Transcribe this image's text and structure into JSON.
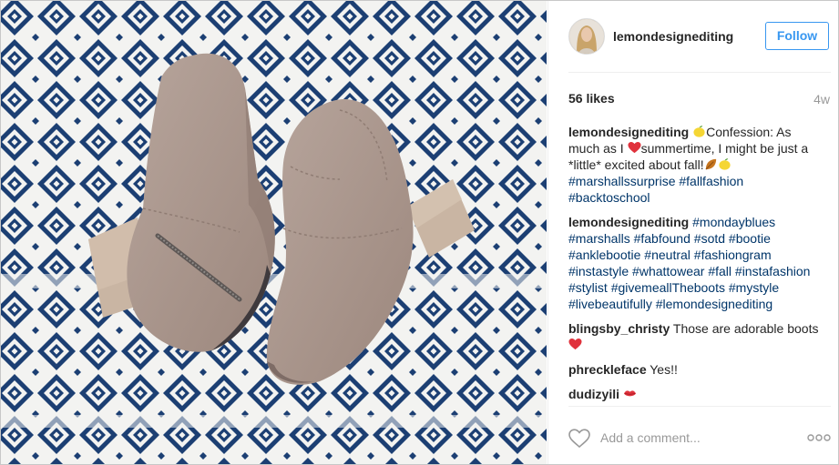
{
  "post": {
    "username": "lemondesignediting",
    "follow_label": "Follow",
    "likes": "56 likes",
    "age": "4w"
  },
  "comments": [
    {
      "user": "lemondesignediting",
      "parts": [
        {
          "t": "emoji",
          "name": "lemon-icon"
        },
        {
          "t": "text",
          "v": "Confession: As much as I "
        },
        {
          "t": "emoji",
          "name": "heart-icon"
        },
        {
          "t": "text",
          "v": "summertime, I might be just a *little* excited about fall!"
        },
        {
          "t": "emoji",
          "name": "leaf-icon"
        },
        {
          "t": "emoji",
          "name": "lemon-icon"
        },
        {
          "t": "tag",
          "v": "#marshallssurprise"
        },
        {
          "t": "text",
          "v": " "
        },
        {
          "t": "tag",
          "v": "#fallfashion"
        },
        {
          "t": "text",
          "v": " "
        },
        {
          "t": "tag",
          "v": "#backtoschool"
        }
      ]
    },
    {
      "user": "lemondesignediting",
      "parts": [
        {
          "t": "tag",
          "v": "#mondayblues"
        },
        {
          "t": "text",
          "v": " "
        },
        {
          "t": "tag",
          "v": "#marshalls"
        },
        {
          "t": "text",
          "v": " "
        },
        {
          "t": "tag",
          "v": "#fabfound"
        },
        {
          "t": "text",
          "v": " "
        },
        {
          "t": "tag",
          "v": "#sotd"
        },
        {
          "t": "text",
          "v": " "
        },
        {
          "t": "tag",
          "v": "#bootie"
        },
        {
          "t": "text",
          "v": " "
        },
        {
          "t": "tag",
          "v": "#anklebootie"
        },
        {
          "t": "text",
          "v": " "
        },
        {
          "t": "tag",
          "v": "#neutral"
        },
        {
          "t": "text",
          "v": " "
        },
        {
          "t": "tag",
          "v": "#fashiongram"
        },
        {
          "t": "text",
          "v": " "
        },
        {
          "t": "tag",
          "v": "#instastyle"
        },
        {
          "t": "text",
          "v": " "
        },
        {
          "t": "tag",
          "v": "#whattowear"
        },
        {
          "t": "text",
          "v": " "
        },
        {
          "t": "tag",
          "v": "#fall"
        },
        {
          "t": "text",
          "v": " "
        },
        {
          "t": "tag",
          "v": "#instafashion"
        },
        {
          "t": "text",
          "v": " "
        },
        {
          "t": "tag",
          "v": "#stylist"
        },
        {
          "t": "text",
          "v": " "
        },
        {
          "t": "tag",
          "v": "#givemeallTheboots"
        },
        {
          "t": "text",
          "v": " "
        },
        {
          "t": "tag",
          "v": "#mystyle"
        },
        {
          "t": "text",
          "v": " "
        },
        {
          "t": "tag",
          "v": "#livebeautifully"
        },
        {
          "t": "text",
          "v": " "
        },
        {
          "t": "tag",
          "v": "#lemondesignediting"
        }
      ]
    },
    {
      "user": "blingsby_christy",
      "parts": [
        {
          "t": "text",
          "v": "Those are adorable boots"
        },
        {
          "t": "emoji",
          "name": "heart-icon"
        }
      ]
    },
    {
      "user": "phreckleface",
      "parts": [
        {
          "t": "text",
          "v": "Yes!!"
        }
      ]
    },
    {
      "user": "dudizyili",
      "parts": [
        {
          "t": "text",
          "v": " "
        },
        {
          "t": "emoji",
          "name": "kiss-icon"
        }
      ]
    }
  ],
  "footer": {
    "comment_placeholder": "Add a comment..."
  },
  "colors": {
    "accent": "#3897f0",
    "hashtag": "#003569",
    "rug_navy": "#1c3f73",
    "rug_white": "#f3f3f1",
    "boot_taupe": "#a8938a"
  }
}
